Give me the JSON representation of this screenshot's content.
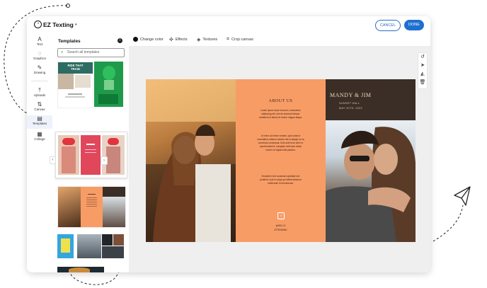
{
  "brand": {
    "name": "EZ Texting",
    "registered": "®"
  },
  "header": {
    "cancel_label": "CANCEL",
    "done_label": "DONE"
  },
  "rail": [
    {
      "label": "Text",
      "icon": "text-icon"
    },
    {
      "label": "Graphics",
      "icon": "graphics-icon"
    },
    {
      "label": "Drawing",
      "icon": "drawing-icon"
    },
    {
      "label": "Uploads",
      "icon": "upload-icon"
    },
    {
      "label": "Canvas",
      "icon": "canvas-icon"
    },
    {
      "label": "Templates",
      "icon": "templates-icon"
    },
    {
      "label": "Collage",
      "icon": "collage-icon"
    }
  ],
  "panel": {
    "title": "Templates",
    "search_placeholder": "Search all templates"
  },
  "thumbs": {
    "t1_line1": "RIDE THAT",
    "t1_line2": "TRAIN"
  },
  "toolbar": {
    "change_color": "Change color",
    "effects": "Effects",
    "textures": "Textures",
    "crop_canvas": "Crop canvas"
  },
  "design": {
    "about_title": "ABOUT US",
    "about_para1": "Lorem ipsum dolor sit amet, consectetur adipiscing elit, sed do eiusmod tempor incididunt ut labore et dolore magna aliqua.",
    "about_para2": "Ut enim ad minim veniam, quis nostrud exercitation ullamco laboris nisi ut aliquip ex ea commodo consequat. Duis aute irure dolor in reprehenderit in voluptate velit esse cillum dolore eu fugiat nulla pariatur.",
    "about_para3": "Excepteur sint occaecat cupidatat non proident, sunt in culpa qui officia deserunt mollit anim id est laborum.",
    "social_handle": "@HELLO",
    "social_sub": "ATTENDING",
    "couple_names": "MANDY & JIM",
    "venue": "SUNSET HALL",
    "date": "MAY 30TH, 2022"
  },
  "colors": {
    "accent": "#1f6fd1",
    "orange": "#f89c66",
    "dark": "#3b2e26"
  }
}
